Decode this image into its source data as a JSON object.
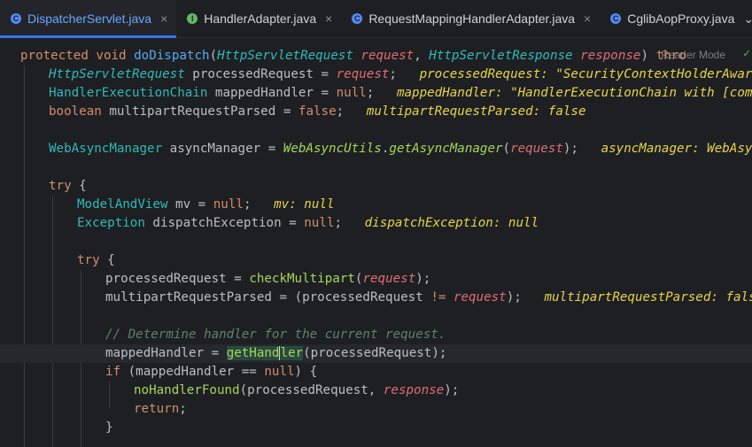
{
  "tabs": [
    {
      "label": "DispatcherServlet.java",
      "icon": "class-icon",
      "active": true
    },
    {
      "label": "HandlerAdapter.java",
      "icon": "interface-icon",
      "active": false
    },
    {
      "label": "RequestMappingHandlerAdapter.java",
      "icon": "class-icon",
      "active": false
    },
    {
      "label": "CglibAopProxy.java",
      "icon": "class-icon",
      "active": false
    }
  ],
  "close_glyph": "×",
  "more_glyph": "⌄",
  "reader_mode": "Reader Mode",
  "check_glyph": "✓",
  "code": {
    "l1": {
      "a": "protected ",
      "b": "void ",
      "c": "doDispatch",
      "d": "(",
      "e": "HttpServletRequest ",
      "f": "request",
      "g": ", ",
      "h": "HttpServletResponse ",
      "i": "response",
      "j": ") ",
      "k": "thro"
    },
    "l2": {
      "a": "HttpServletRequest ",
      "b": "processedRequest ",
      "c": "= ",
      "d": "request",
      "e": ";   ",
      "f": "processedRequest: \"SecurityContextHolderAwareReques"
    },
    "l3": {
      "a": "HandlerExecutionChain ",
      "b": "mappedHandler ",
      "c": "= ",
      "d": "null",
      "e": ";   ",
      "f": "mappedHandler: \"HandlerExecutionChain with [com.uplus."
    },
    "l4": {
      "a": "boolean ",
      "b": "multipartRequestParsed ",
      "c": "= ",
      "d": "false",
      "e": ";   ",
      "f": "multipartRequestParsed: false"
    },
    "l6": {
      "a": "WebAsyncManager ",
      "b": "asyncManager ",
      "c": "= ",
      "d": "WebAsyncUtils",
      "e": ".",
      "f": "getAsyncManager",
      "g": "(",
      "h": "request",
      "i": ");   ",
      "j": "asyncManager: WebAsyncManag"
    },
    "l8": {
      "a": "try ",
      "b": "{"
    },
    "l9": {
      "a": "ModelAndView ",
      "b": "mv ",
      "c": "= ",
      "d": "null",
      "e": ";   ",
      "f": "mv: null"
    },
    "l10": {
      "a": "Exception ",
      "b": "dispatchException ",
      "c": "= ",
      "d": "null",
      "e": ";   ",
      "f": "dispatchException: null"
    },
    "l12": {
      "a": "try ",
      "b": "{"
    },
    "l13": {
      "a": "processedRequest ",
      "b": "= ",
      "c": "checkMultipart",
      "d": "(",
      "e": "request",
      "f": ");"
    },
    "l14": {
      "a": "multipartRequestParsed ",
      "b": "= ",
      "c": "(processedRequest ",
      "d": "!= ",
      "e": "request",
      "f": ");   ",
      "g": "multipartRequestParsed: false"
    },
    "l16": {
      "a": "// Determine handler for the current request."
    },
    "l17": {
      "a": "mappedHandler ",
      "b": "= ",
      "c": "getHand",
      "d": "ler",
      "e": "(processedRequest);"
    },
    "l18": {
      "a": "if ",
      "b": "(mappedHandler ",
      "c": "== ",
      "d": "null",
      "e": ") {"
    },
    "l19": {
      "a": "noHandlerFound",
      "b": "(processedRequest, ",
      "c": "response",
      "d": ");"
    },
    "l20": {
      "a": "return",
      "b": ";"
    },
    "l21": {
      "a": "}"
    }
  }
}
